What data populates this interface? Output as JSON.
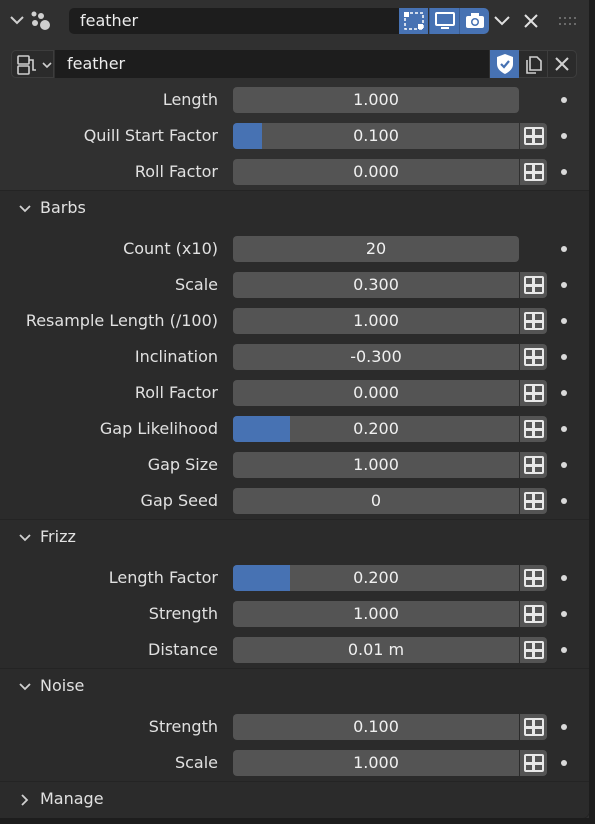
{
  "header": {
    "particle_system_name": "feather",
    "visibility": [
      "edit-mode-icon",
      "viewport-icon",
      "render-icon"
    ]
  },
  "modifier": {
    "name": "feather"
  },
  "top_props": [
    {
      "label": "Length",
      "value": "1.000",
      "fill": 0,
      "driver": false
    },
    {
      "label": "Quill Start Factor",
      "value": "0.100",
      "fill": 0.1,
      "driver": true
    },
    {
      "label": "Roll Factor",
      "value": "0.000",
      "fill": 0,
      "driver": true
    }
  ],
  "barbs": {
    "title": "Barbs",
    "expanded": true,
    "props": [
      {
        "label": "Count (x10)",
        "value": "20",
        "fill": 0,
        "driver": false
      },
      {
        "label": "Scale",
        "value": "0.300",
        "fill": 0,
        "driver": true
      },
      {
        "label": "Resample Length (/100)",
        "value": "1.000",
        "fill": 0,
        "driver": true
      },
      {
        "label": "Inclination",
        "value": "-0.300",
        "fill": 0,
        "driver": true
      },
      {
        "label": "Roll Factor",
        "value": "0.000",
        "fill": 0,
        "driver": true
      },
      {
        "label": "Gap Likelihood",
        "value": "0.200",
        "fill": 0.2,
        "driver": true
      },
      {
        "label": "Gap Size",
        "value": "1.000",
        "fill": 0,
        "driver": true
      },
      {
        "label": "Gap Seed",
        "value": "0",
        "fill": 0,
        "driver": true
      }
    ]
  },
  "frizz": {
    "title": "Frizz",
    "expanded": true,
    "props": [
      {
        "label": "Length Factor",
        "value": "0.200",
        "fill": 0.2,
        "driver": true
      },
      {
        "label": "Strength",
        "value": "1.000",
        "fill": 0,
        "driver": true
      },
      {
        "label": "Distance",
        "value": "0.01 m",
        "fill": 0,
        "driver": true
      }
    ]
  },
  "noise": {
    "title": "Noise",
    "expanded": true,
    "props": [
      {
        "label": "Strength",
        "value": "0.100",
        "fill": 0,
        "driver": true
      },
      {
        "label": "Scale",
        "value": "1.000",
        "fill": 0,
        "driver": true
      }
    ]
  },
  "manage": {
    "title": "Manage",
    "expanded": false
  },
  "colors": {
    "accent": "#4772b3",
    "panel_bg": "#303030",
    "subpanel_bg": "#2b2b2b",
    "field_bg": "#545454"
  }
}
